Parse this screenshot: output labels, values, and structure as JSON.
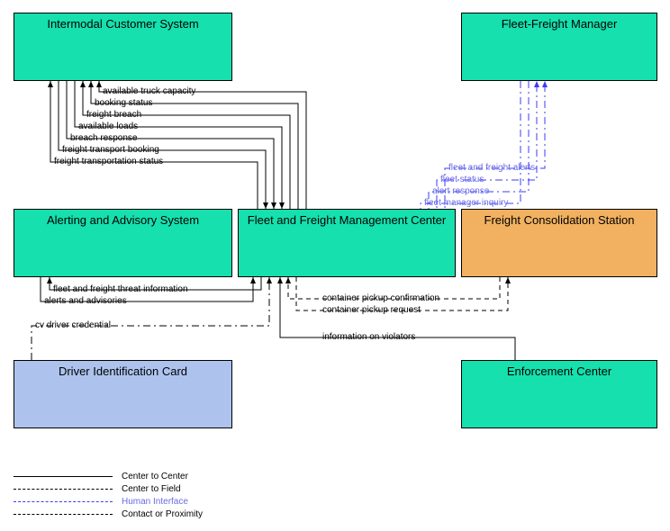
{
  "boxes": {
    "intermodal": "Intermodal Customer System",
    "fleetManager": "Fleet-Freight Manager",
    "alerting": "Alerting and Advisory System",
    "center": "Fleet and Freight Management Center",
    "consolidation": "Freight Consolidation Station",
    "driverCard": "Driver Identification Card",
    "enforcement": "Enforcement Center"
  },
  "links": {
    "truckCapacity": "available truck capacity",
    "bookingStatus": "booking status",
    "freightBreach": "freight breach",
    "availableLoads": "available loads",
    "breachResponse": "breach response",
    "transportBooking": "freight transport booking",
    "transportationStatus": "freight transportation status",
    "threatInfo": "fleet and freight threat information",
    "alerts": "alerts and advisories",
    "cvCredential": "cv driver credential",
    "pickupConfirm": "container pickup confirmation",
    "pickupRequest": "container pickup request",
    "violators": "information on violators",
    "ffAlerts": "fleet and freight alerts",
    "fleetStatus": "fleet status",
    "alertResponse": "alert response",
    "managerInquiry": "fleet manager inquiry"
  },
  "legend": {
    "c2c": "Center to Center",
    "c2f": "Center to Field",
    "hi": "Human Interface",
    "cp": "Contact or Proximity"
  },
  "chart_data": {
    "type": "diagram",
    "title": "Fleet and Freight Management Center context diagram",
    "nodes": [
      {
        "id": "intermodal",
        "label": "Intermodal Customer System",
        "category": "center"
      },
      {
        "id": "fleetManager",
        "label": "Fleet-Freight Manager",
        "category": "human"
      },
      {
        "id": "alerting",
        "label": "Alerting and Advisory System",
        "category": "center"
      },
      {
        "id": "center",
        "label": "Fleet and Freight Management Center",
        "category": "center"
      },
      {
        "id": "consolidation",
        "label": "Freight Consolidation Station",
        "category": "field"
      },
      {
        "id": "driverCard",
        "label": "Driver Identification Card",
        "category": "contact"
      },
      {
        "id": "enforcement",
        "label": "Enforcement Center",
        "category": "center"
      }
    ],
    "edges": [
      {
        "from": "center",
        "to": "intermodal",
        "label": "available truck capacity",
        "type": "Center to Center"
      },
      {
        "from": "center",
        "to": "intermodal",
        "label": "booking status",
        "type": "Center to Center"
      },
      {
        "from": "center",
        "to": "intermodal",
        "label": "freight breach",
        "type": "Center to Center"
      },
      {
        "from": "intermodal",
        "to": "center",
        "label": "available loads",
        "type": "Center to Center"
      },
      {
        "from": "intermodal",
        "to": "center",
        "label": "breach response",
        "type": "Center to Center"
      },
      {
        "from": "intermodal",
        "to": "center",
        "label": "freight transport booking",
        "type": "Center to Center"
      },
      {
        "from": "center",
        "to": "intermodal",
        "label": "freight transportation status",
        "type": "Center to Center"
      },
      {
        "from": "center",
        "to": "alerting",
        "label": "fleet and freight threat information",
        "type": "Center to Center"
      },
      {
        "from": "alerting",
        "to": "center",
        "label": "alerts and advisories",
        "type": "Center to Center"
      },
      {
        "from": "driverCard",
        "to": "center",
        "label": "cv driver credential",
        "type": "Contact or Proximity"
      },
      {
        "from": "consolidation",
        "to": "center",
        "label": "container pickup confirmation",
        "type": "Center to Field"
      },
      {
        "from": "center",
        "to": "consolidation",
        "label": "container pickup request",
        "type": "Center to Field"
      },
      {
        "from": "enforcement",
        "to": "center",
        "label": "information on violators",
        "type": "Center to Center"
      },
      {
        "from": "center",
        "to": "fleetManager",
        "label": "fleet and freight alerts",
        "type": "Human Interface"
      },
      {
        "from": "center",
        "to": "fleetManager",
        "label": "fleet status",
        "type": "Human Interface"
      },
      {
        "from": "fleetManager",
        "to": "center",
        "label": "alert response",
        "type": "Human Interface"
      },
      {
        "from": "fleetManager",
        "to": "center",
        "label": "fleet manager inquiry",
        "type": "Human Interface"
      }
    ],
    "legend": [
      {
        "style": "solid",
        "color": "#000000",
        "label": "Center to Center"
      },
      {
        "style": "dashed",
        "color": "#000000",
        "label": "Center to Field"
      },
      {
        "style": "dash-dot",
        "color": "#3b3bff",
        "label": "Human Interface"
      },
      {
        "style": "dash-dot",
        "color": "#000000",
        "label": "Contact or Proximity"
      }
    ]
  }
}
